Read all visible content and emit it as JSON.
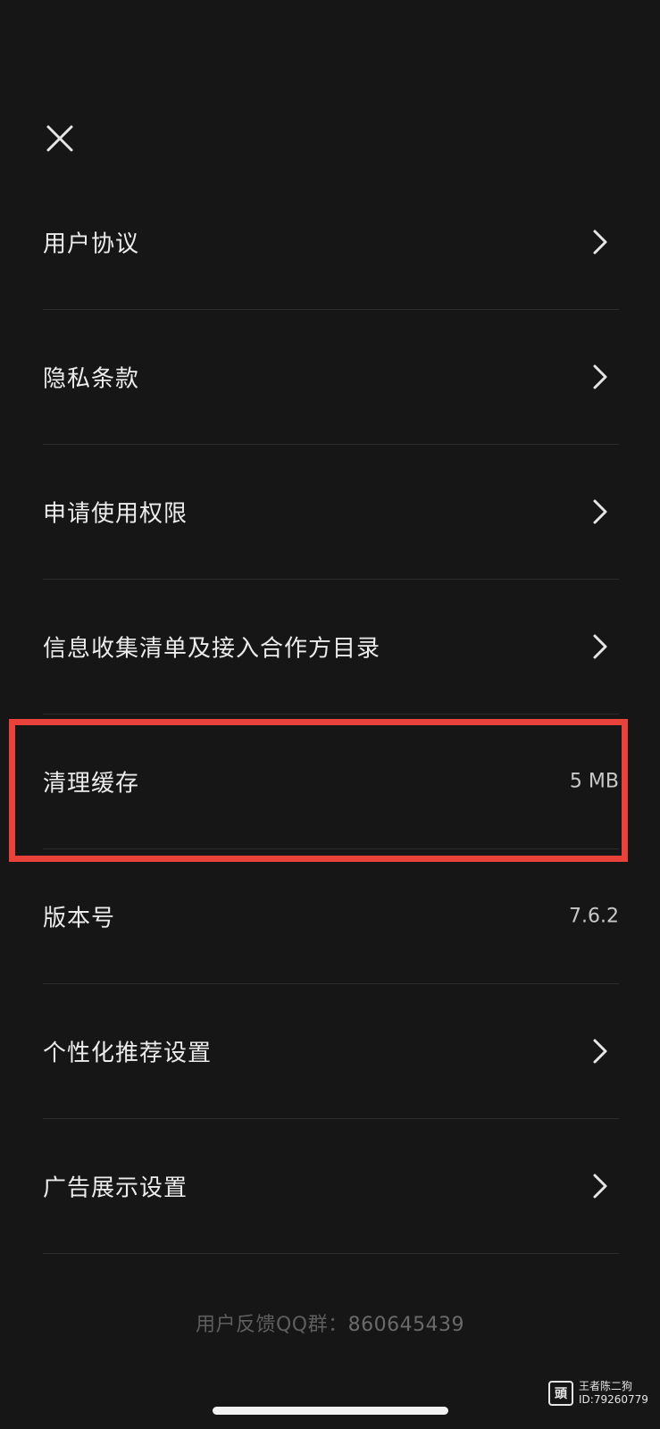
{
  "menu": {
    "items": [
      {
        "label": "用户协议",
        "value": "",
        "has_chevron": true
      },
      {
        "label": "隐私条款",
        "value": "",
        "has_chevron": true
      },
      {
        "label": "申请使用权限",
        "value": "",
        "has_chevron": true
      },
      {
        "label": "信息收集清单及接入合作方目录",
        "value": "",
        "has_chevron": true
      },
      {
        "label": "清理缓存",
        "value": "5 MB",
        "has_chevron": false
      },
      {
        "label": "版本号",
        "value": "7.6.2",
        "has_chevron": false
      },
      {
        "label": "个性化推荐设置",
        "value": "",
        "has_chevron": true
      },
      {
        "label": "广告展示设置",
        "value": "",
        "has_chevron": true
      }
    ]
  },
  "footer": {
    "feedback_label": "用户反馈QQ群：",
    "feedback_number": "860645439"
  },
  "watermark": {
    "line1": "王者陈二狗",
    "line2": "ID:79260779"
  },
  "icons": {
    "close": "close-icon",
    "chevron": "chevron-right-icon"
  },
  "colors": {
    "background": "#161616",
    "text": "#ececec",
    "divider": "#2c2c2c",
    "highlight_border": "#e8423a",
    "footer_text": "#5e5e5e"
  }
}
